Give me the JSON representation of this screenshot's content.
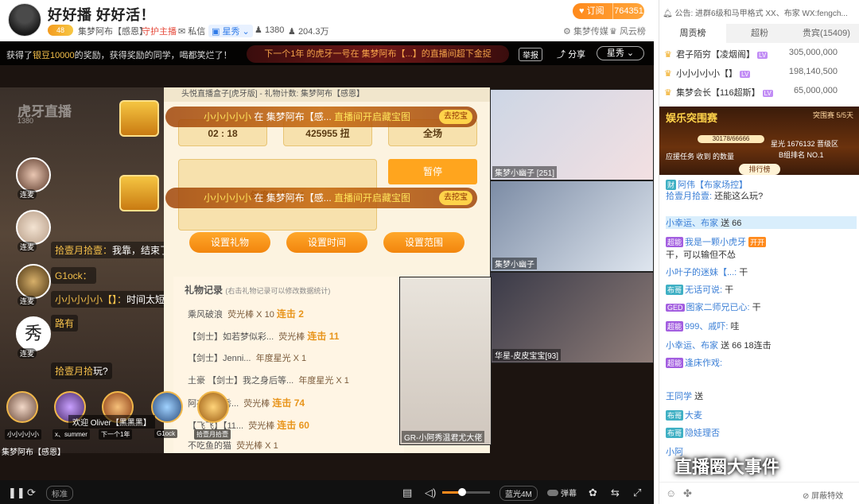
{
  "header": {
    "title": "好好播 好好活！",
    "level": "48",
    "streamer": "集梦阿布【感恩】",
    "guard": "守护主播",
    "dm": "私信",
    "category": "星秀",
    "followers": "1380",
    "viewers": "204.3万",
    "subscribe_label": "订阅",
    "subscribe_count": "764351",
    "group": "集梦传媒",
    "leaderboard": "风云榜"
  },
  "video": {
    "notice_prefix": "获得了",
    "notice_gold": "银豆10000",
    "notice_suffix": "的奖励，获得奖励的同学，喝都笑烂了！",
    "banner": "下一个1年 的虎牙一号在 集梦阿布【...】的直播间超下金捉",
    "report": "举报",
    "share": "分享",
    "star": "星秀",
    "huya_logo": "虎牙直播",
    "huya_id": "1380",
    "tool_title": "头悦直播盒子[虎牙版] - 礼物计数: 集梦阿布【感恩】",
    "timer": "02 : 18",
    "count": "425955 扭",
    "scope": "全场",
    "pause": "暂停",
    "annual": "年度星光 X 1",
    "btn_gift": "设置礼物",
    "btn_time": "设置时间",
    "btn_range": "设置范围",
    "gift_log_title": "礼物记录",
    "gift_log_hint": "(右击礼物记录可以修改数据统计)",
    "gift_rows": [
      {
        "name": "乘风破浪",
        "gift": "荧光棒 X 10",
        "combo": "连击 2"
      },
      {
        "name": "【剑士】如若梦似彩...",
        "gift": "荧光棒",
        "combo": "连击 11"
      },
      {
        "name": "【剑士】Jenni...",
        "gift": "年度星光 X 1",
        "combo": ""
      },
      {
        "name": "土豪 【剑士】我之身后等...",
        "gift": "年度星光 X 1",
        "combo": ""
      },
      {
        "name": "阿布很优秀...",
        "gift": "荧光棒",
        "combo": "连击 74"
      },
      {
        "name": "【飞飞】【11...",
        "gift": "荧光棒",
        "combo": "连击 60"
      },
      {
        "name": "不吃鱼的猫",
        "gift": "荧光棒 X 1",
        "combo": ""
      }
    ],
    "popup1_user": "小小小小小",
    "popup1_mid": "在 集梦阿布【感...",
    "popup1_tail": "直播间开启藏宝图",
    "popup2_user": "小小小小小",
    "popup2_mid": "在 集梦阿布【感...",
    "popup2_tail": "直播间开启藏宝图",
    "dig": "去挖宝",
    "side_avatars": [
      "连麦",
      "连麦",
      "连麦",
      "连麦"
    ],
    "chat_lines": [
      {
        "name": "拾壹月拾壹：",
        "text": "我靠，结束了吗"
      },
      {
        "name": "G1ock：",
        "text": ""
      },
      {
        "name": "小小小小小【】：",
        "text": "时间太短了"
      },
      {
        "name": "路有",
        "text": ""
      },
      {
        "name": "拾壹月拾",
        "text": "玩?"
      }
    ],
    "cam1_label": "集梦小幽子 [251]",
    "cam2_label": "集梦小幽子",
    "cam3_label": "华星-皮皮宝宝[93]",
    "main_cam_label": "GR-小阿秀温君尤大佬",
    "welcome": "欢迎 Oliver【黑黑黑】",
    "bottom_avatars": [
      "小小小小小",
      "x、summer",
      "下一个1年",
      "G1ock",
      "拾壹月拾壹"
    ],
    "streamer_tag": "集梦阿布【感恩】"
  },
  "controls": {
    "quality": "标准",
    "resolution": "蓝光4M",
    "danmu": "弹幕"
  },
  "right": {
    "notice": "公告: 进群6级和马甲格式 XX、布家 WX:fengch...",
    "tabs": [
      "周贡榜",
      "超粉",
      "贵宾(15409)"
    ],
    "ranks": [
      {
        "name": "君子陌穷【凌烟阁】",
        "pts": "305,000,000"
      },
      {
        "name": "小小小小小【】",
        "pts": "198,140,500"
      },
      {
        "name": "集梦会长【116超斯】",
        "pts": "65,000,000"
      }
    ],
    "contest_title": "娱乐突围赛",
    "contest_round": "突围赛 5/5天",
    "contest_bar": "30178/66666",
    "contest_h1": "应援任务 收到 的数量",
    "contest_h2": "星光 1676132 晋级区",
    "contest_h3": "B组排名 NO.1",
    "rank_btn": "排行榜",
    "chat": [
      {
        "name": "阿伟【布家场控】",
        "text": ""
      },
      {
        "name": "拾壹月拾壹:",
        "text": "还能这么玩?"
      },
      {
        "name": "小幸运、布家",
        "text": "送 66"
      },
      {
        "name": "我是一颗小虎牙",
        "text": "开开"
      },
      {
        "name": "",
        "text": "干，可以输但不怂"
      },
      {
        "name": "小叶子的迷妹【...:",
        "text": "干"
      },
      {
        "name": "无话可说:",
        "text": "干"
      },
      {
        "name": "图家二师兄已心:",
        "text": "干"
      },
      {
        "name": "999、戚吓:",
        "text": "哇"
      },
      {
        "name": "小幸运、布家",
        "text": "送 66 18连击"
      },
      {
        "name": "逢床作戏:",
        "text": ""
      },
      {
        "name": "王同学",
        "text": "送"
      },
      {
        "name": "大麦",
        "text": ""
      },
      {
        "name": "隐娃理否",
        "text": ""
      },
      {
        "name": "小阿",
        "text": ""
      }
    ],
    "block_effects": "屏蔽特效"
  },
  "watermark": "直播圈大事件"
}
